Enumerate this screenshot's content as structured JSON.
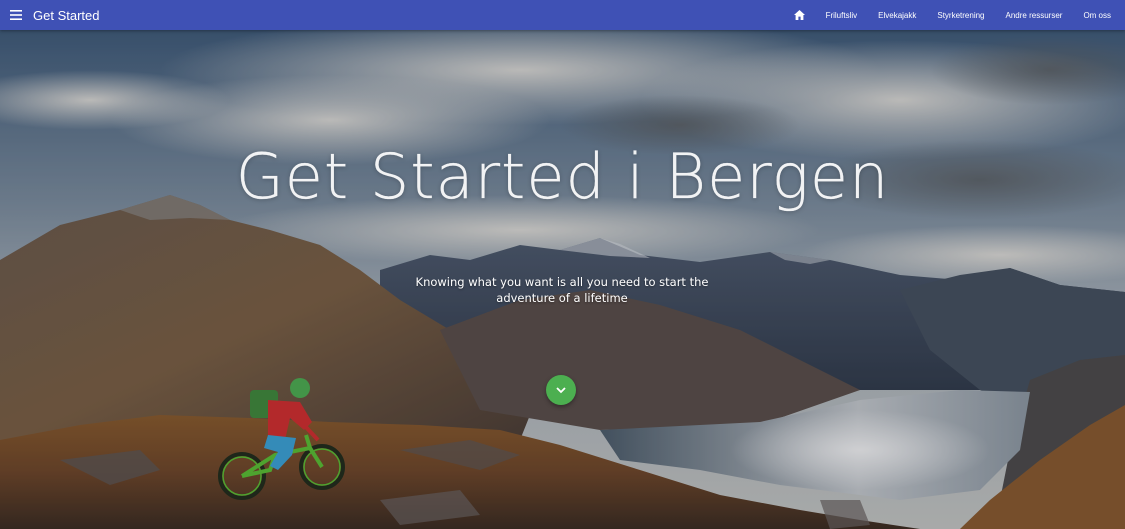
{
  "app": {
    "title": "Get Started"
  },
  "nav": {
    "home_icon": "home-icon",
    "items": [
      "Friluftsliv",
      "Elvekajakk",
      "Styrketrening",
      "Andre ressurser",
      "Om oss"
    ]
  },
  "hero": {
    "title": "Get Started i Bergen",
    "subtitle": "Knowing what you want is all you need to start the adventure of a lifetime",
    "scroll_icon": "chevron-down-icon"
  },
  "colors": {
    "appbar": "#3f51b5",
    "accent": "#4caf50"
  }
}
